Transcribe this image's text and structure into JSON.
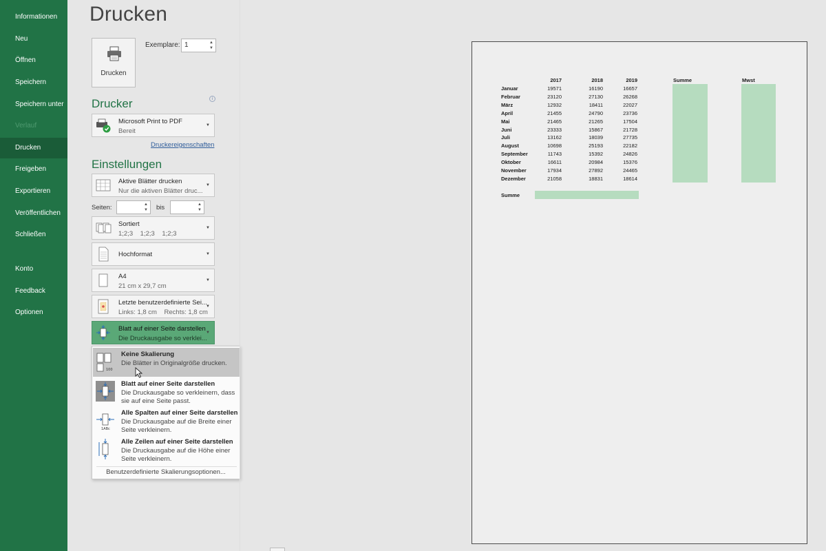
{
  "nav": {
    "items": [
      {
        "label": "Informationen",
        "state": "normal"
      },
      {
        "label": "Neu",
        "state": "normal"
      },
      {
        "label": "Öffnen",
        "state": "normal"
      },
      {
        "label": "Speichern",
        "state": "normal"
      },
      {
        "label": "Speichern unter",
        "state": "normal"
      },
      {
        "label": "Verlauf",
        "state": "disabled"
      },
      {
        "label": "Drucken",
        "state": "active"
      },
      {
        "label": "Freigeben",
        "state": "normal"
      },
      {
        "label": "Exportieren",
        "state": "normal"
      },
      {
        "label": "Veröffentlichen",
        "state": "normal"
      },
      {
        "label": "Schließen",
        "state": "normal"
      },
      {
        "label": "Konto",
        "state": "normal"
      },
      {
        "label": "Feedback",
        "state": "normal"
      },
      {
        "label": "Optionen",
        "state": "normal"
      }
    ]
  },
  "print": {
    "title": "Drucken",
    "button_label": "Drucken",
    "copies_label": "Exemplare:",
    "copies_value": "1"
  },
  "printer": {
    "section_title": "Drucker",
    "name": "Microsoft Print to PDF",
    "status": "Bereit",
    "properties_link": "Druckereigenschaften"
  },
  "settings": {
    "section_title": "Einstellungen",
    "what_title": "Aktive Blätter drucken",
    "what_sub": "Nur die aktiven Blätter druc...",
    "pages_label": "Seiten:",
    "to_label": "bis",
    "pages_from": "",
    "pages_to": "",
    "collate_title": "Sortiert",
    "collate_sub": "1;2;3    1;2;3    1;2;3",
    "orientation": "Hochformat",
    "paper_title": "A4",
    "paper_sub": "21 cm x 29,7 cm",
    "margins_title": "Letzte benutzerdefinierte Sei...",
    "margins_sub": "Links: 1,8 cm    Rechts: 1,8 cm",
    "scaling_title": "Blatt auf einer Seite darstellen",
    "scaling_sub": "Die Druckausgabe so verklei..."
  },
  "scaling_menu": {
    "options": [
      {
        "title": "Keine Skalierung",
        "desc": "Die Blätter in Originalgröße drucken.",
        "icon": "no-scaling-icon",
        "hover": true
      },
      {
        "title": "Blatt auf einer Seite darstellen",
        "desc": "Die Druckausgabe so verkleinern, dass sie auf eine Seite passt.",
        "icon": "fit-sheet-icon",
        "selected": true
      },
      {
        "title": "Alle Spalten auf einer Seite darstellen",
        "desc": "Die Druckausgabe auf die Breite einer Seite verkleinern.",
        "icon": "fit-columns-icon"
      },
      {
        "title": "Alle Zeilen auf einer Seite darstellen",
        "desc": "Die Druckausgabe auf die Höhe einer Seite verkleinern.",
        "icon": "fit-rows-icon"
      }
    ],
    "custom": "Benutzerdefinierte Skalierungsoptionen..."
  },
  "preview": {
    "years": [
      "2017",
      "2018",
      "2019"
    ],
    "sum_header": "Summe",
    "mwst_header": "Mwst",
    "rows": [
      {
        "month": "Januar",
        "values": [
          "19571",
          "16190",
          "16657"
        ]
      },
      {
        "month": "Februar",
        "values": [
          "23120",
          "27130",
          "26268"
        ]
      },
      {
        "month": "März",
        "values": [
          "12932",
          "18411",
          "22027"
        ]
      },
      {
        "month": "April",
        "values": [
          "21455",
          "24790",
          "23736"
        ]
      },
      {
        "month": "Mai",
        "values": [
          "21465",
          "21265",
          "17504"
        ]
      },
      {
        "month": "Juni",
        "values": [
          "23333",
          "15867",
          "21728"
        ]
      },
      {
        "month": "Juli",
        "values": [
          "13162",
          "18039",
          "27735"
        ]
      },
      {
        "month": "August",
        "values": [
          "10698",
          "25193",
          "22182"
        ]
      },
      {
        "month": "September",
        "values": [
          "11743",
          "15392",
          "24826"
        ]
      },
      {
        "month": "Oktober",
        "values": [
          "16611",
          "20984",
          "15376"
        ]
      },
      {
        "month": "November",
        "values": [
          "17934",
          "27892",
          "24465"
        ]
      },
      {
        "month": "Dezember",
        "values": [
          "21058",
          "18831",
          "18614"
        ]
      }
    ],
    "sum_row_label": "Summe",
    "highlight_color": "#b6dcbf"
  },
  "colors": {
    "brand_green": "#217346",
    "active_nav": "#1a5c38",
    "selected_dropdown": "#5aa877"
  }
}
